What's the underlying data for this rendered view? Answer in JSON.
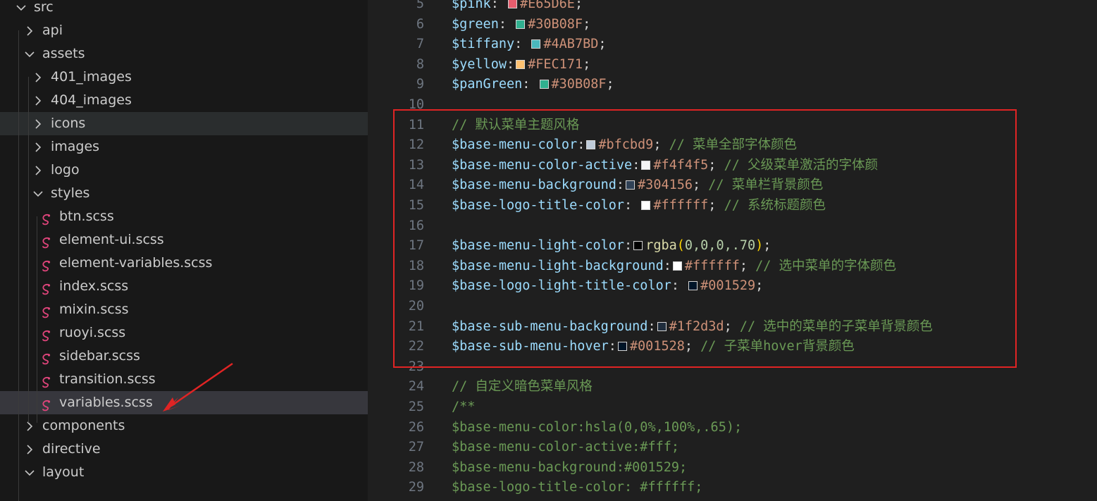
{
  "explorer": {
    "items": [
      {
        "label": "src",
        "kind": "folder",
        "expanded": true
      },
      {
        "label": "api",
        "kind": "folder",
        "expanded": false
      },
      {
        "label": "assets",
        "kind": "folder",
        "expanded": true
      },
      {
        "label": "401_images",
        "kind": "folder",
        "expanded": false
      },
      {
        "label": "404_images",
        "kind": "folder",
        "expanded": false
      },
      {
        "label": "icons",
        "kind": "folder",
        "expanded": false
      },
      {
        "label": "images",
        "kind": "folder",
        "expanded": false
      },
      {
        "label": "logo",
        "kind": "folder",
        "expanded": false
      },
      {
        "label": "styles",
        "kind": "folder",
        "expanded": true
      },
      {
        "label": "btn.scss",
        "kind": "file",
        "icon": "sass-icon"
      },
      {
        "label": "element-ui.scss",
        "kind": "file",
        "icon": "sass-icon"
      },
      {
        "label": "element-variables.scss",
        "kind": "file",
        "icon": "sass-icon"
      },
      {
        "label": "index.scss",
        "kind": "file",
        "icon": "sass-icon"
      },
      {
        "label": "mixin.scss",
        "kind": "file",
        "icon": "sass-icon"
      },
      {
        "label": "ruoyi.scss",
        "kind": "file",
        "icon": "sass-icon"
      },
      {
        "label": "sidebar.scss",
        "kind": "file",
        "icon": "sass-icon"
      },
      {
        "label": "transition.scss",
        "kind": "file",
        "icon": "sass-icon"
      },
      {
        "label": "variables.scss",
        "kind": "file",
        "icon": "sass-icon",
        "selected": true
      },
      {
        "label": "components",
        "kind": "folder",
        "expanded": false
      },
      {
        "label": "directive",
        "kind": "folder",
        "expanded": false
      },
      {
        "label": "layout",
        "kind": "folder",
        "expanded": true
      }
    ],
    "hovered_item": "icons",
    "selected_item": "variables.scss"
  },
  "editor": {
    "lines": [
      {
        "n": "5",
        "var": "$pink",
        "sep": ": ",
        "swatch": "#E65D6E",
        "value": "#E65D6E",
        "tail": ";"
      },
      {
        "n": "6",
        "var": "$green",
        "sep": ": ",
        "swatch": "#30B08F",
        "value": "#30B08F",
        "tail": ";"
      },
      {
        "n": "7",
        "var": "$tiffany",
        "sep": ": ",
        "swatch": "#4AB7BD",
        "value": "#4AB7BD",
        "tail": ";"
      },
      {
        "n": "8",
        "var": "$yellow",
        "sep": ":",
        "swatch": "#FEC171",
        "value": "#FEC171",
        "tail": ";"
      },
      {
        "n": "9",
        "var": "$panGreen",
        "sep": ": ",
        "swatch": "#30B08F",
        "value": "#30B08F",
        "tail": ";"
      },
      {
        "n": "10"
      },
      {
        "n": "11",
        "comment": "// 默认菜单主题风格"
      },
      {
        "n": "12",
        "var": "$base-menu-color",
        "sep": ":",
        "swatch": "#bfcbd9",
        "value": "#bfcbd9",
        "tail": "; ",
        "comment": "// 菜单全部字体颜色"
      },
      {
        "n": "13",
        "var": "$base-menu-color-active",
        "sep": ":",
        "swatch": "#f4f4f5",
        "value": "#f4f4f5",
        "tail": "; ",
        "comment": "// 父级菜单激活的字体颜"
      },
      {
        "n": "14",
        "var": "$base-menu-background",
        "sep": ":",
        "swatch": "#304156",
        "value": "#304156",
        "tail": "; ",
        "comment": "// 菜单栏背景颜色"
      },
      {
        "n": "15",
        "var": "$base-logo-title-color",
        "sep": ": ",
        "swatch": "#ffffff",
        "value": "#ffffff",
        "tail": "; ",
        "comment": "// 系统标题颜色"
      },
      {
        "n": "16"
      },
      {
        "n": "17",
        "var": "$base-menu-light-color",
        "sep": ":",
        "swatch": "#000000",
        "fn": "rgba",
        "args": "0,0,0,.70",
        "tail": ";"
      },
      {
        "n": "18",
        "var": "$base-menu-light-background",
        "sep": ":",
        "swatch": "#ffffff",
        "value": "#ffffff",
        "tail": "; ",
        "comment": "// 选中菜单的字体颜色"
      },
      {
        "n": "19",
        "var": "$base-logo-light-title-color",
        "sep": ": ",
        "swatch": "#001529",
        "value": "#001529",
        "tail": ";"
      },
      {
        "n": "20"
      },
      {
        "n": "21",
        "var": "$base-sub-menu-background",
        "sep": ":",
        "swatch": "#1f2d3d",
        "value": "#1f2d3d",
        "tail": "; ",
        "comment": "// 选中的菜单的子菜单背景颜色"
      },
      {
        "n": "22",
        "var": "$base-sub-menu-hover",
        "sep": ":",
        "swatch": "#001528",
        "value": "#001528",
        "tail": "; ",
        "comment": "// 子菜单hover背景颜色"
      },
      {
        "n": "23"
      },
      {
        "n": "24",
        "comment": "// 自定义暗色菜单风格"
      },
      {
        "n": "25",
        "comment": "/**"
      },
      {
        "n": "26",
        "comment": "$base-menu-color:hsla(0,0%,100%,.65);"
      },
      {
        "n": "27",
        "comment": "$base-menu-color-active:#fff;"
      },
      {
        "n": "28",
        "comment": "$base-menu-background:#001529;"
      },
      {
        "n": "29",
        "comment": "$base-logo-title-color: #ffffff;"
      }
    ],
    "highlighted_range": "11-23",
    "highlight_color": "#e02424"
  },
  "annotation": {
    "arrow_color": "#e02424",
    "points_to": "variables.scss"
  }
}
